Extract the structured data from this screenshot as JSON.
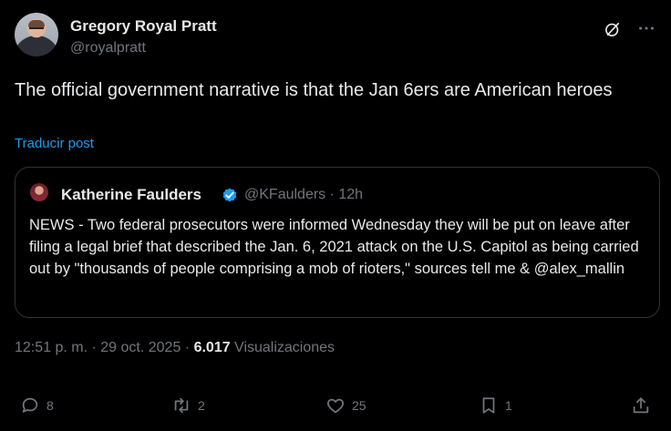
{
  "author": {
    "name": "Gregory Royal Pratt",
    "handle": "@royalpratt"
  },
  "post": {
    "text": "The official government narrative is that the Jan 6ers are American heroes",
    "translate_label": "Traducir post"
  },
  "quoted": {
    "name": "Katherine Faulders",
    "meta": "@KFaulders · 12h",
    "text": "NEWS - Two federal prosecutors were informed Wednesday they will be put on leave after filing a legal brief that described the Jan. 6, 2021 attack on the U.S. Capitol as being carried out by \"thousands of people comprising a mob of rioters,\" sources tell me & @alex_mallin"
  },
  "meta": {
    "time": "12:51 p. m. · 29 oct. 2025 · ",
    "views_count": "6.017",
    "views_label": " Visualizaciones"
  },
  "actions": {
    "replies": "8",
    "reposts": "2",
    "likes": "25",
    "bookmarks": "1"
  },
  "colors": {
    "background": "#000000",
    "text": "#e7e9ea",
    "secondary": "#71767b",
    "accent": "#1d9bf0",
    "border": "#2f3336"
  },
  "icons": [
    "grok-icon",
    "more-icon",
    "verified-badge-icon",
    "reply-icon",
    "repost-icon",
    "like-icon",
    "bookmark-icon",
    "share-icon"
  ]
}
